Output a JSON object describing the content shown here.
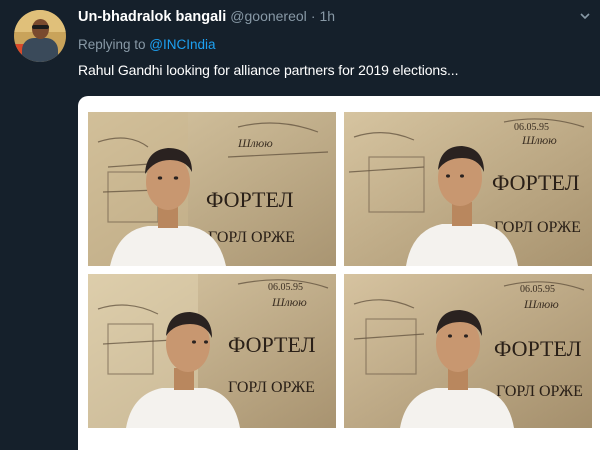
{
  "tweet": {
    "author_name": "Un-bhadralok bangali",
    "handle": "@goonereol",
    "separator": "·",
    "time": "1h",
    "replying_prefix": "Replying to ",
    "replying_to": "@INCIndia",
    "text": "Rahul Gandhi looking for alliance partners for 2019 elections...",
    "icons": {
      "avatar": "user-avatar",
      "menu": "chevron-down-icon"
    }
  },
  "photos": {
    "wall_text_1": "ФОРТЕЛ",
    "wall_text_2": "ГОРЛ ОРЖЕ",
    "wall_text_3": "Шлюю",
    "wall_text_4": "06.05.95",
    "wall_text_5": "фортель"
  },
  "colors": {
    "background": "#15202b",
    "secondary_text": "#8899a6",
    "link": "#1da1f2",
    "text": "#ffffff"
  }
}
